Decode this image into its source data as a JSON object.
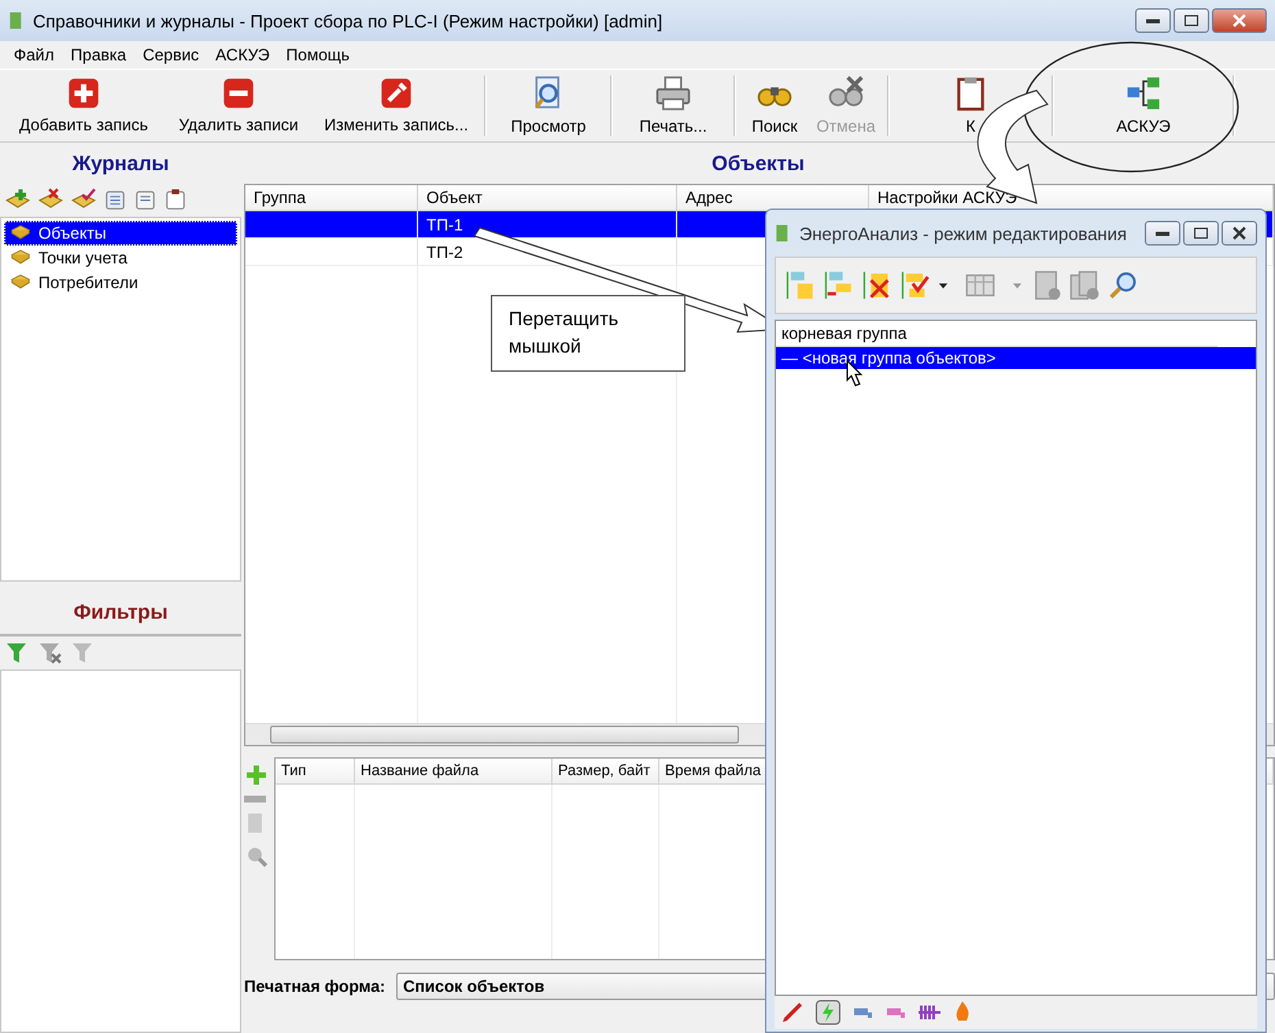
{
  "window": {
    "title": "Справочники и журналы - Проект сбора по PLC-I (Режим настройки) [admin]"
  },
  "menu": [
    "Файл",
    "Правка",
    "Сервис",
    "АСКУЭ",
    "Помощь"
  ],
  "toolbar": [
    {
      "kind": "add",
      "label": "Добавить запись",
      "disabled": false
    },
    {
      "kind": "delete",
      "label": "Удалить записи",
      "disabled": false
    },
    {
      "kind": "edit",
      "label": "Изменить запись...",
      "disabled": false
    },
    {
      "kind": "preview",
      "label": "Просмотр",
      "disabled": false
    },
    {
      "kind": "print",
      "label": "Печать...",
      "disabled": false
    },
    {
      "kind": "search",
      "label": "Поиск",
      "disabled": false
    },
    {
      "kind": "cancel",
      "label": "Отмена",
      "disabled": true
    },
    {
      "kind": "clipboard",
      "label": "К",
      "disabled": false
    },
    {
      "kind": "askue",
      "label": "АСКУЭ",
      "disabled": false
    }
  ],
  "journals": {
    "title": "Журналы",
    "items": [
      {
        "label": "Объекты",
        "selected": true
      },
      {
        "label": "Точки учета",
        "selected": false
      },
      {
        "label": "Потребители",
        "selected": false
      }
    ]
  },
  "objects": {
    "title": "Объекты",
    "columns": [
      "Группа",
      "Объект",
      "Адрес",
      "Настройки АСКУЭ"
    ],
    "rows": [
      {
        "object": "ТП-1",
        "selected": true
      },
      {
        "object": "ТП-2",
        "selected": false
      }
    ]
  },
  "filters": {
    "title": "Фильтры"
  },
  "files": {
    "columns": [
      "Тип",
      "Название файла",
      "Размер, байт",
      "Время файла"
    ]
  },
  "print_form": {
    "label": "Печатная форма:",
    "value": "Список объектов"
  },
  "callout": {
    "text": "Перетащить мышкой"
  },
  "dialog": {
    "title": "ЭнергоАнализ - режим редактирования",
    "tree_header": "корневая группа",
    "items": [
      {
        "label": "— <новая группа объектов>",
        "selected": true
      }
    ]
  }
}
